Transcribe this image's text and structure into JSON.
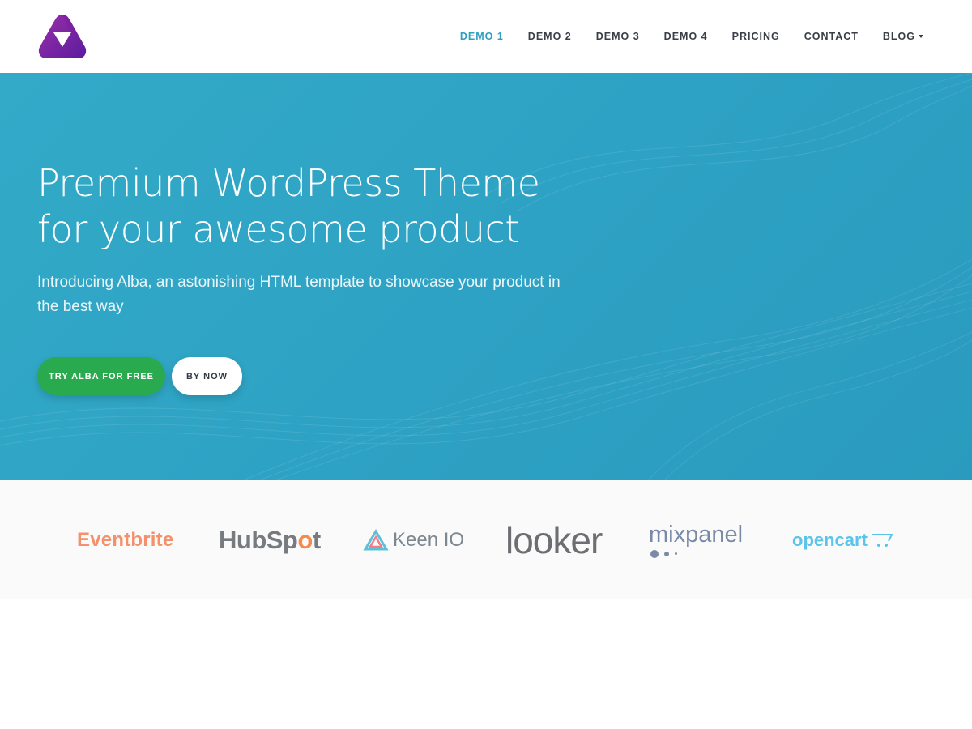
{
  "header": {
    "logo_icon": "triangle-logo-icon",
    "nav": [
      {
        "label": "DEMO 1",
        "active": true
      },
      {
        "label": "DEMO 2",
        "active": false
      },
      {
        "label": "DEMO 3",
        "active": false
      },
      {
        "label": "DEMO 4",
        "active": false
      },
      {
        "label": "PRICING",
        "active": false
      },
      {
        "label": "CONTACT",
        "active": false
      },
      {
        "label": "BLOG",
        "active": false,
        "dropdown": true
      }
    ]
  },
  "hero": {
    "title_line1": "Premium WordPress Theme",
    "title_line2": "for your awesome product",
    "subtitle": "Introducing Alba, an astonishing HTML template to showcase your product in the best way",
    "primary_button": "TRY ALBA FOR FREE",
    "secondary_button": "BY NOW"
  },
  "brands": {
    "eventbrite": "Eventbrite",
    "hubspot_pre": "HubSp",
    "hubspot_o": "o",
    "hubspot_post": "t",
    "keen": "Keen IO",
    "looker": "looker",
    "mixpanel": "mixpanel",
    "opencart": "opencart"
  },
  "colors": {
    "accent": "#2f9fc0",
    "hero_bg": "#2ea2c4",
    "primary_button": "#2aaa4f",
    "eventbrite": "#f5906b",
    "hubspot_accent": "#f58a4c",
    "opencart": "#5cc3ea",
    "mixpanel": "#7a8aa6"
  }
}
